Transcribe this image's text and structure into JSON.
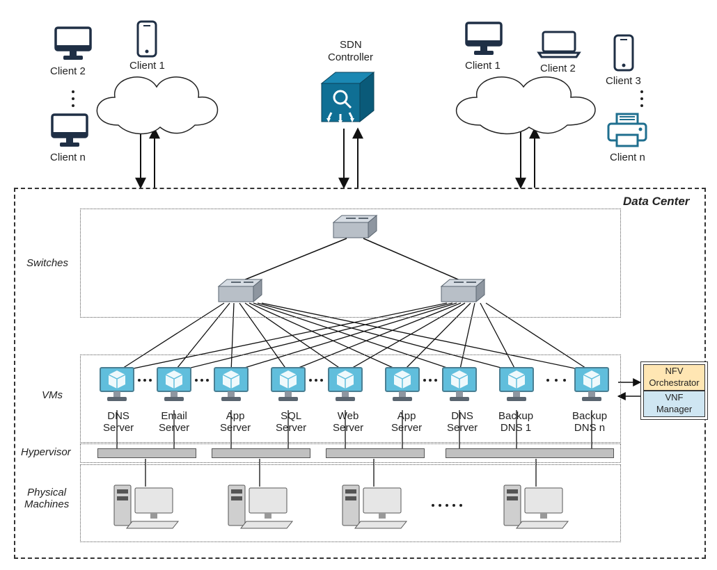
{
  "sdn": {
    "title_line1": "SDN",
    "title_line2": "Controller"
  },
  "left_clients": {
    "client1": "Client 1",
    "client2": "Client 2",
    "clientn": "Client n"
  },
  "right_clients": {
    "client1": "Client 1",
    "client2": "Client 2",
    "client3": "Client 3",
    "clientn": "Client n"
  },
  "datacenter": {
    "title": "Data Center",
    "sections": {
      "switches": "Switches",
      "vms": "VMs",
      "hypervisor": "Hypervisor",
      "physical": "Physical\nMachines"
    },
    "vms": [
      {
        "label_line1": "DNS",
        "label_line2": "Server"
      },
      {
        "label_line1": "Email",
        "label_line2": "Server"
      },
      {
        "label_line1": "App",
        "label_line2": "Server"
      },
      {
        "label_line1": "SQL",
        "label_line2": "Server"
      },
      {
        "label_line1": "Web",
        "label_line2": "Server"
      },
      {
        "label_line1": "App",
        "label_line2": "Server"
      },
      {
        "label_line1": "DNS",
        "label_line2": "Server"
      },
      {
        "label_line1": "Backup",
        "label_line2": "DNS 1"
      },
      {
        "label_line1": "Backup",
        "label_line2": "DNS n"
      }
    ],
    "nfv": {
      "orchestrator": "NFV\nOrchestrator",
      "manager": "VNF\nManager"
    }
  }
}
